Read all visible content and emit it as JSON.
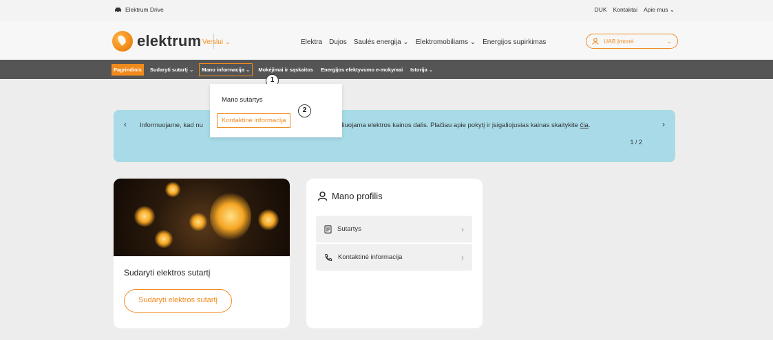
{
  "top_strip": {
    "brand": "Elektrum Drive",
    "links": [
      "DUK",
      "Kontaktai",
      "Apie mus"
    ]
  },
  "header": {
    "logo_text": "elektrum",
    "segment": "Verslui",
    "nav": [
      "Elektra",
      "Dujos",
      "Saulės energija",
      "Elektromobiliams",
      "Energijos supirkimas"
    ],
    "account": "UAB Įmonė"
  },
  "subnav": {
    "items": [
      {
        "label": "Pagrindinis",
        "active": true
      },
      {
        "label": "Sudaryti sutartį",
        "has_dropdown": true
      },
      {
        "label": "Mano informacija",
        "has_dropdown": true
      },
      {
        "label": "Mokėjimai ir sąskaitos"
      },
      {
        "label": "Energijos efektyvumo e-mokymai"
      },
      {
        "label": "Istorija",
        "has_dropdown": true
      }
    ]
  },
  "callouts": {
    "one": "1",
    "two": "2"
  },
  "dropdown": {
    "items": [
      "Mano sutartys",
      "Kontaktinė informacija"
    ]
  },
  "banner": {
    "text_left": "Informuojame, kad nu",
    "text_right": "uliuojama elektros kainos dalis. Plačiau apie pokytį ir įsigaliojusias kainas skaitykite",
    "link": "čia",
    "pager": "1 / 2"
  },
  "contract_card": {
    "title": "Sudaryti elektros sutartį",
    "button": "Sudaryti elektros sutartį"
  },
  "profile_card": {
    "title": "Mano profilis",
    "rows": [
      "Sutartys",
      "Kontaktinė informacija"
    ]
  },
  "colors": {
    "accent": "#f08a1c",
    "dark_bar": "#555555",
    "banner": "#a8dbe7"
  }
}
